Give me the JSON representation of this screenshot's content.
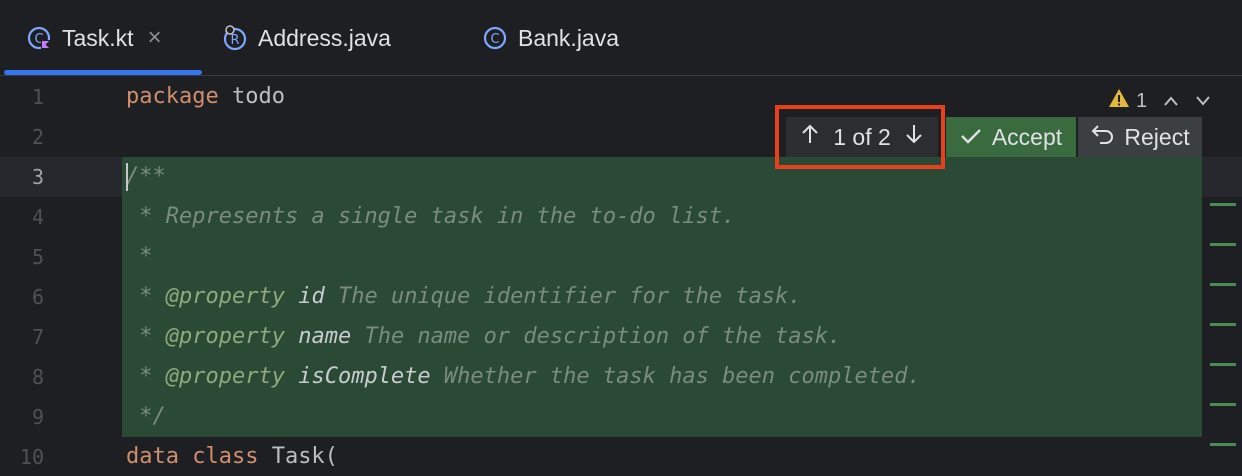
{
  "tabs": [
    {
      "label": "Task.kt",
      "icon": "kotlin-class-icon",
      "active": true,
      "closable": true
    },
    {
      "label": "Address.java",
      "icon": "java-record-icon",
      "active": false
    },
    {
      "label": "Bank.java",
      "icon": "java-class-icon",
      "active": false
    }
  ],
  "tab_close_glyph": "×",
  "inspection": {
    "warning_count": "1",
    "icon": "warning-triangle-icon"
  },
  "diff_nav": {
    "label": "1 of 2",
    "prev_icon": "arrow-up-icon",
    "next_icon": "arrow-down-icon"
  },
  "accept_label": "Accept",
  "reject_label": "Reject",
  "line_numbers": [
    "1",
    "2",
    "3",
    "4",
    "5",
    "6",
    "7",
    "8",
    "9",
    "10"
  ],
  "code": {
    "l1_kw": "package",
    "l1_rest": " todo",
    "l3": "/**",
    "l4": " * Represents a single task in the to-do list.",
    "l5": " *",
    "l6_star": " * ",
    "l6_tag": "@property",
    "l6_prm": " id",
    "l6_txt": " The unique identifier for the task.",
    "l7_star": " * ",
    "l7_tag": "@property",
    "l7_prm": " name",
    "l7_txt": " The name or description of the task.",
    "l8_star": " * ",
    "l8_tag": "@property",
    "l8_prm": " isComplete",
    "l8_txt": " Whether the task has been completed.",
    "l9": " */",
    "l10_kw": "data class",
    "l10_rest": " Task("
  },
  "colors": {
    "accent": "#3574f0",
    "diff_bg": "#2b4a35",
    "accept_bg": "#3a6b3f",
    "highlight": "#e8401c"
  }
}
